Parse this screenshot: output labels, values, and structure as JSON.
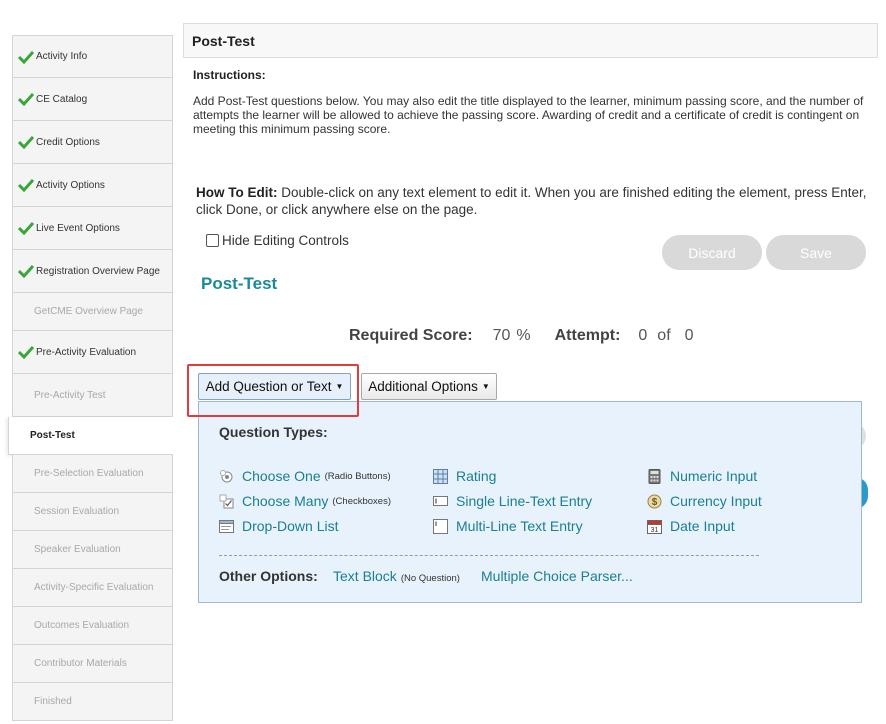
{
  "sidebar": {
    "items": [
      {
        "label": "Activity Info",
        "state": "completed"
      },
      {
        "label": "CE Catalog",
        "state": "completed"
      },
      {
        "label": "Credit Options",
        "state": "completed"
      },
      {
        "label": "Activity Options",
        "state": "completed"
      },
      {
        "label": "Live Event Options",
        "state": "completed"
      },
      {
        "label": "Registration Overview Page",
        "state": "completed"
      },
      {
        "label": "GetCME Overview Page",
        "state": "disabled"
      },
      {
        "label": "Pre-Activity Evaluation",
        "state": "completed"
      },
      {
        "label": "Pre-Activity Test",
        "state": "disabled"
      },
      {
        "label": "Post-Test",
        "state": "active"
      },
      {
        "label": "Pre-Selection Evaluation",
        "state": "disabled"
      },
      {
        "label": "Session Evaluation",
        "state": "disabled"
      },
      {
        "label": "Speaker Evaluation",
        "state": "disabled"
      },
      {
        "label": "Activity-Specific Evaluation",
        "state": "disabled"
      },
      {
        "label": "Outcomes Evaluation",
        "state": "disabled"
      },
      {
        "label": "Contributor Materials",
        "state": "disabled"
      },
      {
        "label": "Finished",
        "state": "disabled"
      }
    ],
    "check_icon": "check-icon",
    "check_color": "#3aa53a"
  },
  "header": {
    "title": "Post-Test"
  },
  "instructions": {
    "title": "Instructions:",
    "text": "Add Post-Test questions below. You may also edit the title displayed to the learner, minimum passing score, and the number of attempts the learner will be allowed to achieve the passing score. Awarding of credit and a certificate of credit is contingent on meeting this minimum passing score."
  },
  "howto": {
    "label": "How To Edit:",
    "text": " Double-click on any text element to edit it. When you are finished editing the element, press Enter, click Done, or click anywhere else on the page."
  },
  "hide_controls": {
    "label": "Hide Editing Controls",
    "checked": false
  },
  "buttons": {
    "discard": "Discard",
    "save": "Save"
  },
  "test": {
    "title": "Post-Test",
    "required_score_label": "Required Score:",
    "required_score_value": "70",
    "percent": "%",
    "attempt_label": "Attempt:",
    "attempt_value": "0",
    "of": "of",
    "attempt_max": "0"
  },
  "toolbar": {
    "add_question": "Add Question or Text",
    "additional_options": "Additional Options",
    "caret": "▼"
  },
  "question_types": {
    "title": "Question Types:",
    "items": [
      {
        "label": "Choose One",
        "note": "(Radio Buttons)",
        "icon": "radio-icon"
      },
      {
        "label": "Choose Many",
        "note": "(Checkboxes)",
        "icon": "checkbox-icon"
      },
      {
        "label": "Drop-Down List",
        "note": "",
        "icon": "dropdown-list-icon"
      },
      {
        "label": "Rating",
        "note": "",
        "icon": "rating-grid-icon"
      },
      {
        "label": "Single Line-Text Entry",
        "note": "",
        "icon": "single-line-icon"
      },
      {
        "label": "Multi-Line Text Entry",
        "note": "",
        "icon": "multi-line-icon"
      },
      {
        "label": "Numeric Input",
        "note": "",
        "icon": "calculator-icon"
      },
      {
        "label": "Currency Input",
        "note": "",
        "icon": "dollar-icon"
      },
      {
        "label": "Date Input",
        "note": "",
        "icon": "calendar-icon"
      }
    ],
    "calendar_day": "31"
  },
  "other_options": {
    "label": "Other Options:",
    "text_block": "Text Block",
    "text_block_note": "(No Question)",
    "parser": "Multiple Choice Parser..."
  }
}
